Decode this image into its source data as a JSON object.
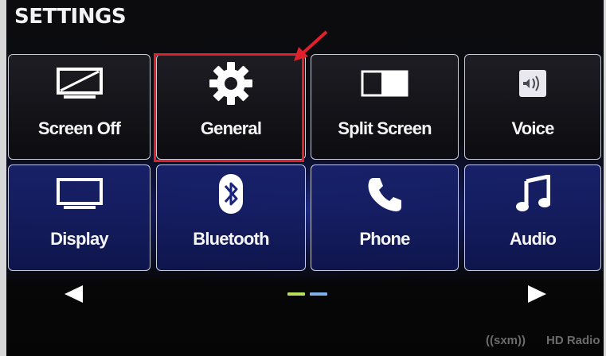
{
  "header": {
    "title": "SETTINGS"
  },
  "tiles": [
    {
      "label": "Screen Off",
      "icon": "screen-off-icon"
    },
    {
      "label": "General",
      "icon": "gear-icon"
    },
    {
      "label": "Split Screen",
      "icon": "split-screen-icon"
    },
    {
      "label": "Voice",
      "icon": "voice-icon"
    },
    {
      "label": "Display",
      "icon": "display-icon"
    },
    {
      "label": "Bluetooth",
      "icon": "bluetooth-icon"
    },
    {
      "label": "Phone",
      "icon": "phone-icon"
    },
    {
      "label": "Audio",
      "icon": "music-note-icon"
    }
  ],
  "pagination": {
    "pages": 2,
    "current": 1,
    "colors": {
      "active": "#b8e05a",
      "inactive": "#7fb0e8"
    }
  },
  "annotation": {
    "highlight_color": "#e0202a",
    "highlighted_tile": "General"
  },
  "footer": {
    "brand_sxm": "((sxm))",
    "brand_hd": "HD Radio"
  },
  "colors": {
    "tile_border": "#c9ccd6",
    "background": "#0a0b12",
    "accent_blue": "#1a2480"
  }
}
